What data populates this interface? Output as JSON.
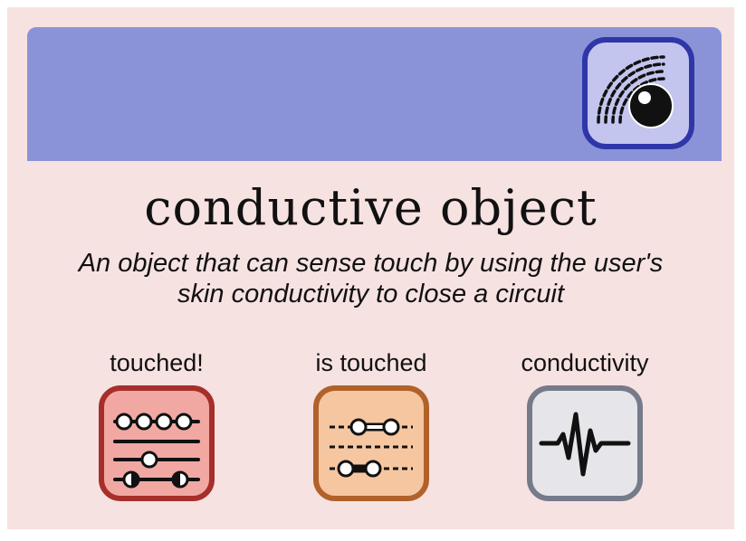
{
  "title": "conductive object",
  "description": {
    "line1": "An object that can sense touch by using the user's",
    "line2": "skin conductivity to close a circuit"
  },
  "colors": {
    "card_background": "#f7e2e2",
    "banner": "#8b93d8",
    "hero_icon_border": "#2f36a8",
    "hero_icon_fill": "#c3c5ee",
    "touched_border": "#a62f2a",
    "touched_fill": "#f1a8a3",
    "is_touched_border": "#b0622a",
    "is_touched_fill": "#f6c6a0",
    "conductivity_border": "#767b8a",
    "conductivity_fill": "#e6e6ea"
  },
  "hero_icon": "touch-sensor-icon",
  "tiles": [
    {
      "label": "touched!",
      "icon": "event-sliders-icon"
    },
    {
      "label": "is touched",
      "icon": "toggle-sliders-icon"
    },
    {
      "label": "conductivity",
      "icon": "waveform-icon"
    }
  ]
}
